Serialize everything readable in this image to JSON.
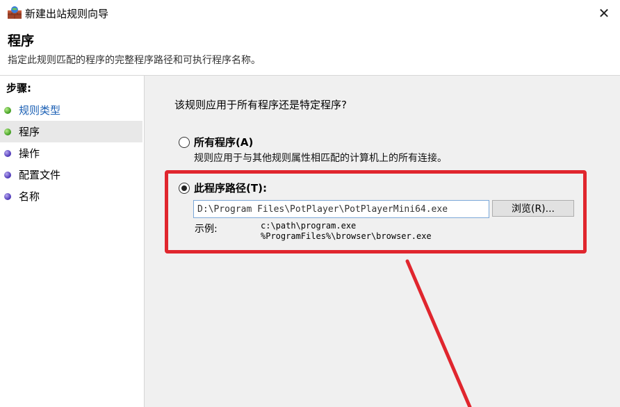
{
  "window": {
    "title": "新建出站规则向导",
    "close_glyph": "✕"
  },
  "header": {
    "title": "程序",
    "subtitle": "指定此规则匹配的程序的完整程序路径和可执行程序名称。"
  },
  "sidebar": {
    "heading": "步骤:",
    "items": [
      {
        "label": "规则类型",
        "dot": "green",
        "state": "link"
      },
      {
        "label": "程序",
        "dot": "green",
        "state": "active"
      },
      {
        "label": "操作",
        "dot": "purple",
        "state": "pending"
      },
      {
        "label": "配置文件",
        "dot": "purple",
        "state": "pending"
      },
      {
        "label": "名称",
        "dot": "purple",
        "state": "pending"
      }
    ]
  },
  "main": {
    "question": "该规则应用于所有程序还是特定程序?",
    "all_programs": {
      "label": "所有程序(A)",
      "description": "规则应用于与其他规则属性相匹配的计算机上的所有连接。",
      "checked": false
    },
    "this_program": {
      "label": "此程序路径(T):",
      "checked": true,
      "path_value": "D:\\Program Files\\PotPlayer\\PotPlayerMini64.exe",
      "browse_label": "浏览(R)...",
      "example_label": "示例:",
      "example_lines": [
        "c:\\path\\program.exe",
        "%ProgramFiles%\\browser\\browser.exe"
      ]
    }
  },
  "annotation": {
    "color": "#e0262e"
  }
}
